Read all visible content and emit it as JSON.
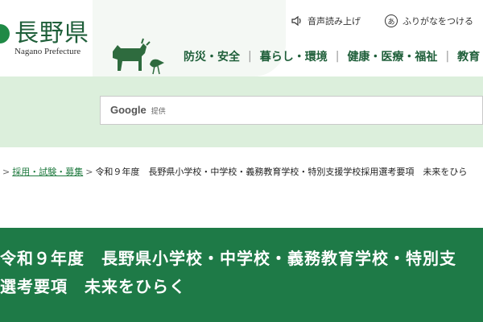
{
  "header": {
    "logo_title": "長野県",
    "logo_subtitle": "Nagano Prefecture",
    "util_read": "音声読み上げ",
    "util_furigana": "ふりがなをつける",
    "furigana_icon_char": "あ"
  },
  "nav": {
    "items": [
      "防災・安全",
      "暮らし・環境",
      "健康・医療・福祉",
      "教育・"
    ]
  },
  "search": {
    "brand": "Google",
    "provided": "提供"
  },
  "breadcrumb": {
    "link": "採用・試験・募集",
    "current": "令和９年度　長野県小学校・中学校・義務教育学校・特別支援学校採用選考要項　未来をひら"
  },
  "title": {
    "line1": "令和９年度　長野県小学校・中学校・義務教育学校・特別支",
    "line2": "選考要項　未来をひらく"
  },
  "colors": {
    "brand_green": "#1e7a47",
    "search_band": "#dcefdc",
    "link_green": "#1f7a3f"
  }
}
